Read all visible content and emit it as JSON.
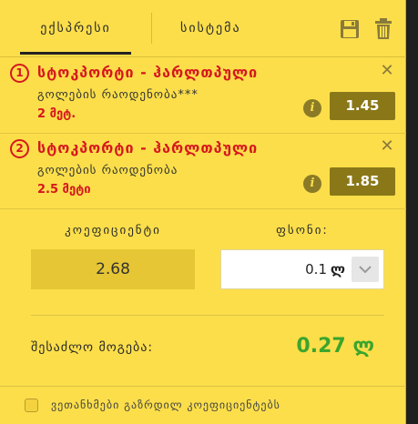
{
  "tabs": [
    {
      "label": "ექსპრესი",
      "active": true
    },
    {
      "label": "სისტემა",
      "active": false
    }
  ],
  "toolbar": {
    "save_icon": "floppy-save-icon",
    "trash_icon": "trash-icon"
  },
  "bets": [
    {
      "number": "1",
      "title": "სტოკპორტი - ჰარლთპული",
      "market": "გოლების რაოდენობა***",
      "selection": "2 მეტ.",
      "odds": "1.45"
    },
    {
      "number": "2",
      "title": "სტოკპორტი - ჰარლთპული",
      "market": "გოლების რაოდენობა",
      "selection": "2.5 მეტი",
      "odds": "1.85"
    }
  ],
  "summary": {
    "coefficient_label": "კოეფიციენტი",
    "coefficient_value": "2.68",
    "stake_label": "ფსონი:",
    "stake_value": "0.1",
    "currency": "ლ",
    "possible_win_label": "შესაძლო მოგება:",
    "possible_win_value": "0.27 ლ"
  },
  "accept_higher_odds": {
    "label": "ვეთანხმები გაზრდილ კოეფიციენტებს",
    "checked": false
  },
  "colors": {
    "panel": "#fbde4a",
    "accent_red": "#d6171e",
    "odds_box": "#8a7818",
    "win_green": "#3ba52d"
  }
}
